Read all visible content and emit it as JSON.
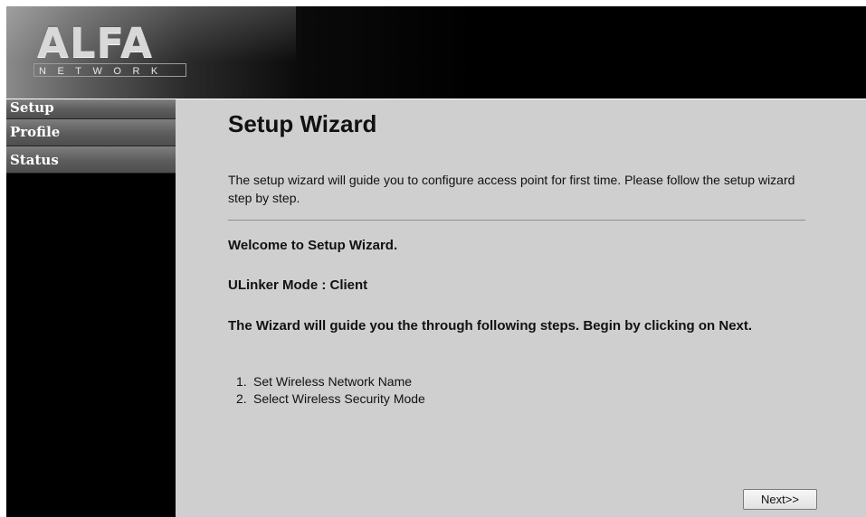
{
  "header": {
    "logo_main": "ALFA",
    "logo_sub": "NETWORK"
  },
  "sidebar": {
    "items": [
      {
        "label": "Setup"
      },
      {
        "label": "Profile"
      },
      {
        "label": "Status"
      }
    ]
  },
  "main": {
    "title": "Setup Wizard",
    "intro": "The setup wizard will guide you to configure access point for first time. Please follow the setup wizard step by step.",
    "welcome": "Welcome to Setup Wizard.",
    "mode": "ULinker Mode : Client",
    "wizard_text": "The Wizard will guide you the through following steps. Begin by clicking on Next.",
    "steps": [
      {
        "num": "1.",
        "text": "Set Wireless Network Name"
      },
      {
        "num": "2.",
        "text": "Select Wireless Security Mode"
      }
    ],
    "next_label": "Next>>"
  },
  "colors": {
    "content_bg": "#cfcfcf",
    "sidebar_bg": "#000000",
    "nav_item_bg": "#6a6a6a",
    "nav_text": "#ffffff"
  }
}
